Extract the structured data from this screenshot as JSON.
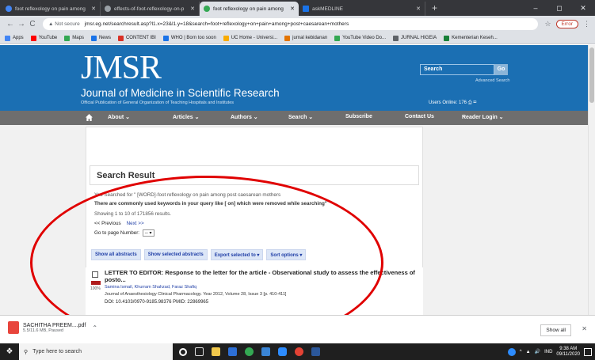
{
  "browser": {
    "tabs": [
      {
        "label": "foot reflexology on pain among",
        "active": false
      },
      {
        "label": "effects-of-foot-reflexology-on-p",
        "active": false
      },
      {
        "label": "foot reflexology on pain among",
        "active": true
      },
      {
        "label": "askMEDLINE",
        "active": false
      }
    ],
    "new_tab": "+",
    "window_controls": [
      "–",
      "◻",
      "✕"
    ],
    "security_label": "Not secure",
    "url": "jmsr.eg.net/searchresult.asp?l1.x=23&l1.y=18&search=foot+reflexology+on+pain+among+post+caesarean+mothers",
    "error_label": "Error",
    "bookmarks": [
      {
        "label": "Apps",
        "color": "#4285f4"
      },
      {
        "label": "YouTube",
        "color": "#ff0000"
      },
      {
        "label": "Maps",
        "color": "#34a853"
      },
      {
        "label": "News",
        "color": "#1a73e8"
      },
      {
        "label": "CONTENT IBI",
        "color": "#d93025"
      },
      {
        "label": "WHO | Born too soon",
        "color": "#1a73e8"
      },
      {
        "label": "UC Home - Universi...",
        "color": "#f9ab00"
      },
      {
        "label": "jurnal kebidanan",
        "color": "#e37400"
      },
      {
        "label": "YouTube Video Do...",
        "color": "#34a853"
      },
      {
        "label": "JURNAL HIGEIA",
        "color": "#5f6368"
      },
      {
        "label": "Kementerian Keseh...",
        "color": "#188038"
      }
    ]
  },
  "site": {
    "logo": "JMSR",
    "journal_name": "Journal of Medicine in Scientific Research",
    "journal_sub": "Official Publication of General Organization of Teaching Hospitals and Institutes",
    "search_placeholder": "Search",
    "go_label": "Go",
    "advanced_search": "Advanced Search",
    "users_online": "Users Online: 176",
    "nav": [
      {
        "label": "About ⌄"
      },
      {
        "label": "Articles ⌄"
      },
      {
        "label": "Authors ⌄"
      },
      {
        "label": "Search ⌄"
      },
      {
        "label": "Subscribe"
      },
      {
        "label": "Contact Us"
      },
      {
        "label": "Reader Login ⌄"
      }
    ]
  },
  "results": {
    "title": "Search Result",
    "searched_for": "You Searched for \" [WORD]-foot reflexology on pain among post caesarean mothers",
    "keywords_note": "There are commonly used keywords in your query like [ on] which were removed while searching\"",
    "showing": "Showing 1 to 10 of 171856 results.",
    "previous": "<< Previous",
    "next": "Next >>",
    "goto_label": "Go to page Number:",
    "goto_value": "--",
    "buttons": [
      "Show all abstracts",
      "Show selected abstracts",
      "Export selected to ▾",
      "Sort options ▾"
    ],
    "article": {
      "title": "LETTER TO EDITOR: Response to the letter for the article - Observational study to assess the effectiveness of posto...",
      "percent": "100%",
      "authors": "Samina Ismail, Khurram Shahzad, Faraz Shafiq",
      "journal": "Journal of Anaesthesiology Clinical Pharmacology. Year 2012, Volume 28, Issue 3 [p. 410-411]",
      "doi": "DOI: 10.4103/0970-9185.98376 PMID: 22869965"
    }
  },
  "downloads": {
    "file_name": "SACHITHA PREEM....pdf",
    "status": "5.5/11.6 MB, Paused",
    "show_all": "Show all"
  },
  "taskbar": {
    "search_placeholder": "Type here to search",
    "lang": "IND",
    "time": "9:38 AM",
    "date": "09/11/2020"
  }
}
